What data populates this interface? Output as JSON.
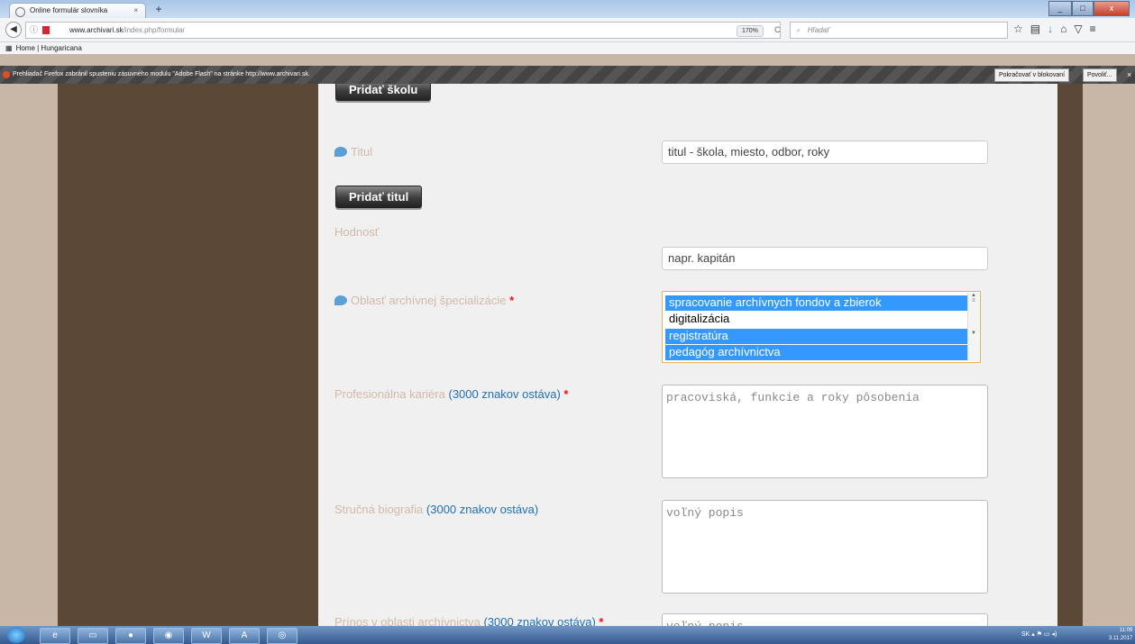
{
  "browser": {
    "tab_title": "Online formulár slovníka",
    "tab_close": "×",
    "new_tab": "+",
    "url_host": "www.archivari.sk",
    "url_path": "/index.php/formular",
    "zoom": "170%",
    "search_placeholder": "Hľadať",
    "bookmark": "Home | Hungaricana"
  },
  "flash_bar": {
    "message": "Prehliadač Firefox zabránil spusteniu zásuvného modulu \"Adobe Flash\" na stránke http://www.archivari.sk.",
    "continue_blocking": "Pokračovať v blokovaní",
    "allow": "Povoliť...",
    "close": "×"
  },
  "form": {
    "add_school_button": "Pridať školu",
    "title_label": "Titul",
    "title_placeholder": "titul - škola, miesto, odbor, roky",
    "add_title_button": "Pridať titul",
    "rank_label": "Hodnosť",
    "rank_placeholder": "napr. kapitán",
    "specialization_label": "Oblasť archívnej špecializácie",
    "required_mark": "*",
    "specialization_options": [
      {
        "text": "spracovanie archívnych fondov a zbierok",
        "selected": true
      },
      {
        "text": "digitalizácia",
        "selected": false
      },
      {
        "text": "registratúra",
        "selected": true
      },
      {
        "text": "pedagóg archívnictva",
        "selected": true
      }
    ],
    "career_label": "Profesionálna kariéra",
    "career_counter": "(3000 znakov ostáva)",
    "career_placeholder": "pracoviská, funkcie a roky pôsobenia",
    "bio_label": "Stručná biografia",
    "bio_counter": "(3000 znakov ostáva)",
    "bio_placeholder": "voľný popis",
    "contribution_label": "Prínos v oblasti archívnictva",
    "contribution_counter": "(3000 znakov ostáva)",
    "contribution_placeholder": "voľný popis"
  },
  "taskbar": {
    "language": "SK",
    "time": "11:09",
    "date": "3.11.2017"
  },
  "colors": {
    "page_background": "#c8b7a6",
    "side_column": "#5b4836",
    "label_color": "#d3b9a8",
    "counter_color": "#1f6fb5",
    "selection": "#3399ff"
  }
}
